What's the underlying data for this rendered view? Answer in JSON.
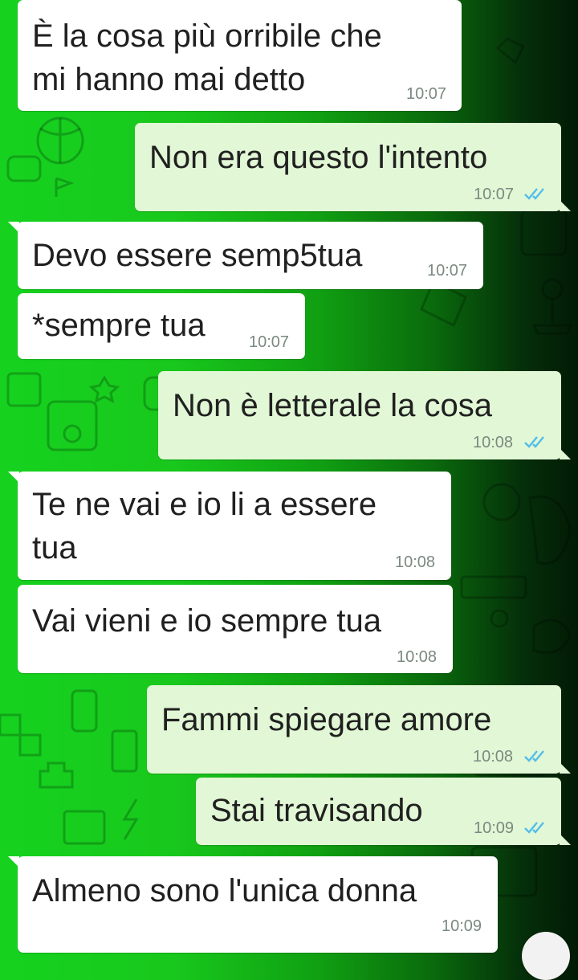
{
  "chat": {
    "messages": [
      {
        "direction": "in",
        "lines": [
          "È la cosa più orribile che",
          "mi hanno mai detto"
        ],
        "time": "10:07"
      },
      {
        "direction": "out",
        "lines": [
          "Non era questo l'intento"
        ],
        "time": "10:07",
        "status": "read"
      },
      {
        "direction": "in",
        "lines": [
          "Devo essere semp5tua"
        ],
        "time": "10:07"
      },
      {
        "direction": "in",
        "lines": [
          "*sempre tua"
        ],
        "time": "10:07"
      },
      {
        "direction": "out",
        "lines": [
          "Non è letterale la cosa"
        ],
        "time": "10:08",
        "status": "read"
      },
      {
        "direction": "in",
        "lines": [
          "Te ne vai e io li a essere",
          "tua"
        ],
        "time": "10:08"
      },
      {
        "direction": "in",
        "lines": [
          "Vai vieni e io sempre tua"
        ],
        "time": "10:08"
      },
      {
        "direction": "out",
        "lines": [
          "Fammi spiegare amore"
        ],
        "time": "10:08",
        "status": "read"
      },
      {
        "direction": "out",
        "lines": [
          "Stai travisando"
        ],
        "time": "10:09",
        "status": "read"
      },
      {
        "direction": "in",
        "lines": [
          "Almeno sono l'unica donna"
        ],
        "time": "10:09"
      }
    ]
  },
  "colors": {
    "incoming_bubble": "#ffffff",
    "outgoing_bubble": "#e1f7d5",
    "read_ticks": "#53bdeb",
    "wallpaper_start": "#16d21f",
    "wallpaper_end": "#021a05"
  },
  "icons": {
    "read_receipt": "double-check-icon",
    "wallpaper": "doodle-pattern"
  }
}
